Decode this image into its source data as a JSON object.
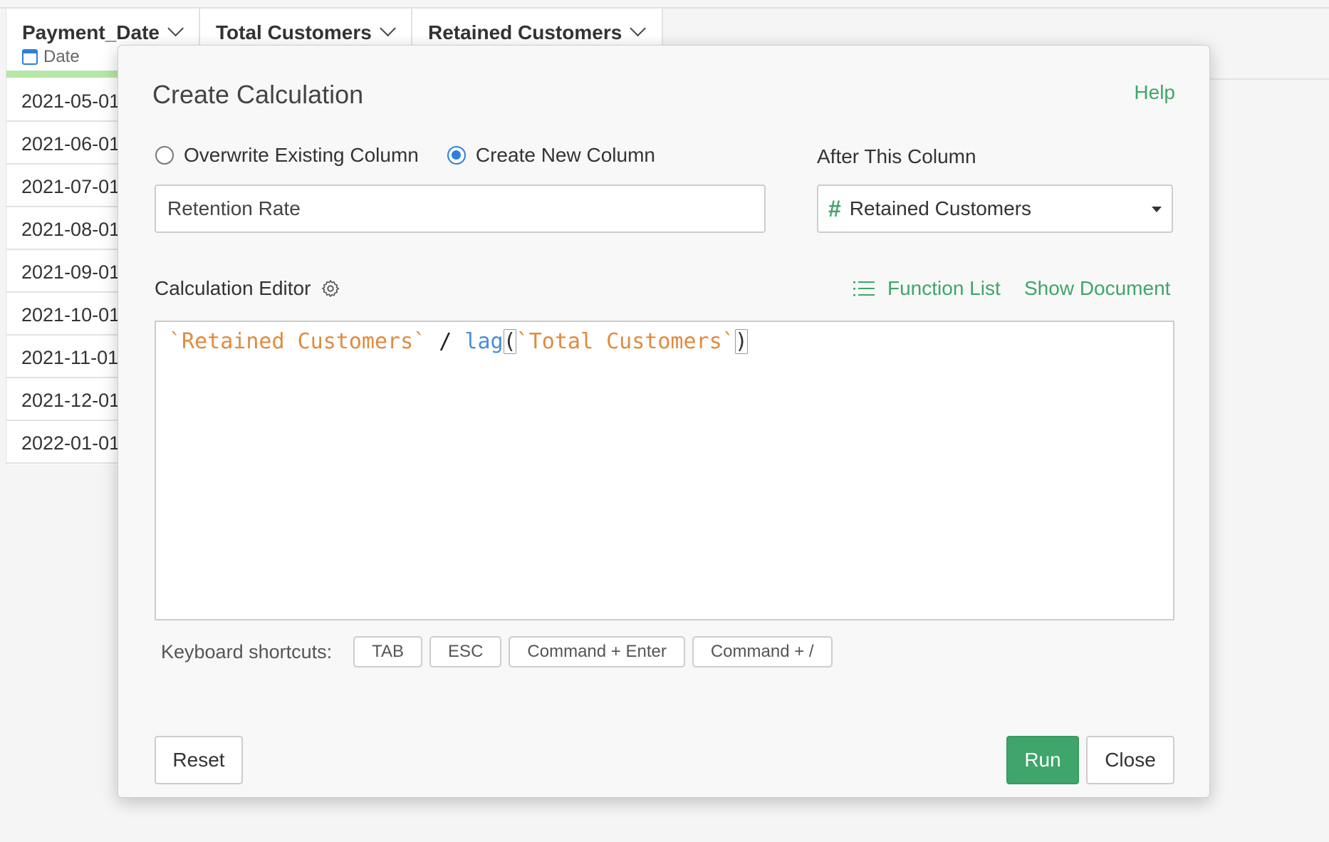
{
  "table": {
    "columns": [
      {
        "name": "Payment_Date",
        "type": "Date"
      },
      {
        "name": "Total Customers"
      },
      {
        "name": "Retained Customers"
      }
    ],
    "rows": [
      "2021-05-01",
      "2021-06-01",
      "2021-07-01",
      "2021-08-01",
      "2021-09-01",
      "2021-10-01",
      "2021-11-01",
      "2021-12-01",
      "2022-01-01"
    ]
  },
  "dialog": {
    "title": "Create Calculation",
    "help": "Help",
    "options": {
      "overwrite": "Overwrite Existing Column",
      "create_new": "Create New Column",
      "selected": "create_new"
    },
    "new_column_value": "Retention Rate",
    "after_label": "After This Column",
    "after_value": "Retained Customers",
    "editor_label": "Calculation Editor",
    "function_list": "Function List",
    "show_document": "Show Document",
    "expression": {
      "col1": "`Retained Customers`",
      "op": " / ",
      "fn": "lag",
      "open": "(",
      "col2": "`Total Customers`",
      "close": ")"
    },
    "shortcuts_label": "Keyboard shortcuts:",
    "shortcuts": [
      "TAB",
      "ESC",
      "Command + Enter",
      "Command + /"
    ],
    "reset": "Reset",
    "run": "Run",
    "close": "Close"
  },
  "colors": {
    "accent": "#3fa56a",
    "radio": "#2f7fd9",
    "token_column": "#e08b3e",
    "token_function": "#4a8ed8"
  }
}
